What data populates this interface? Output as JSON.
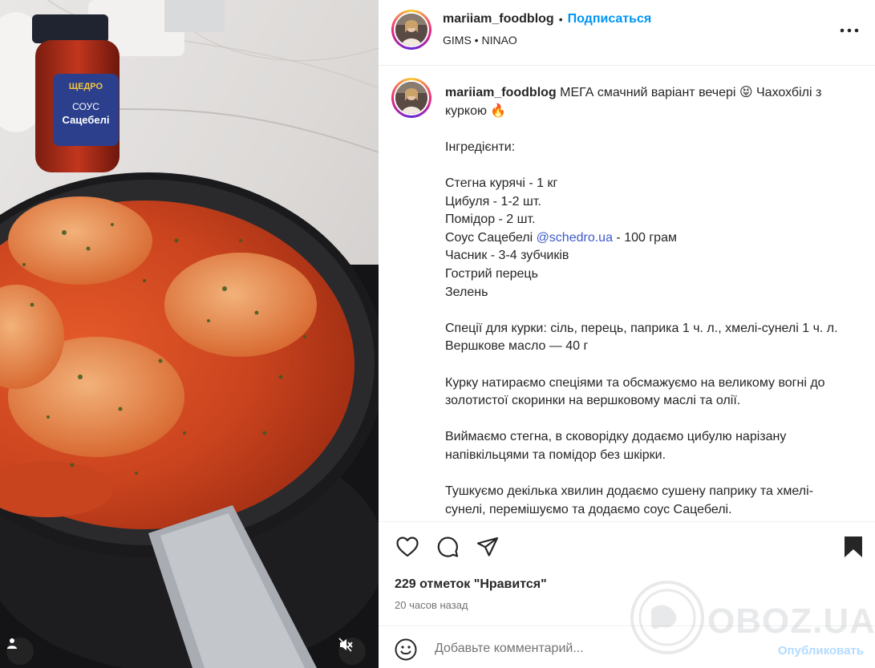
{
  "post": {
    "username": "mariiam_foodblog",
    "dot": "•",
    "follow_label": "Подписаться",
    "audio": "GIMS • NINAO",
    "more_icon": "more-horizontal-icon"
  },
  "caption": {
    "username": "mariiam_foodblog",
    "intro": " МЕГА смачний варіант вечері 😝 Чахохбілі з куркою 🔥",
    "ingredients_heading": "Інгредієнти:",
    "items": [
      "Стегна курячі - 1 кг",
      "Цибуля - 1-2 шт.",
      "Помідор - 2 шт.",
      "Соус Сацебелі ",
      "Часник - 3-4 зубчиків",
      "Гострий перець",
      "Зелень"
    ],
    "mention": "@schedro.ua",
    "after_mention": " - 100 грам",
    "spices": "Спеції для курки: сіль, перець, паприка 1 ч. л., хмелі-сунелі 1 ч. л.",
    "butter": "Вершкове масло — 40 г",
    "step1": "Курку натираємо спеціями та обсмажуємо на великому вогні до золотистої скоринки на вершковому маслі та олії.",
    "step2": "Виймаємо стегна, в сковорідку додаємо цибулю нарізану напівкільцями та помідор без шкірки.",
    "step3": "Тушкуємо декілька хвилин додаємо сушену паприку та хмелі-сунелі, перемішуємо та додаємо соус Сацебелі."
  },
  "actions": {
    "likes": "229 отметок \"Нравится\"",
    "time": "20 часов назад",
    "icons": [
      "heart-icon",
      "comment-icon",
      "share-icon",
      "bookmark-icon"
    ]
  },
  "comment": {
    "placeholder": "Добавьте комментарий...",
    "post_label": "Опубликовать"
  },
  "media": {
    "jar_brand": "ЩЕДРО",
    "jar_line1": "СОУС",
    "jar_line2": "Сацебелі"
  },
  "watermark": {
    "text": "OBOZ.UA"
  },
  "colors": {
    "accent": "#0095f6",
    "mention": "#3d5ac9",
    "muted": "#737373",
    "border": "#efefef"
  }
}
